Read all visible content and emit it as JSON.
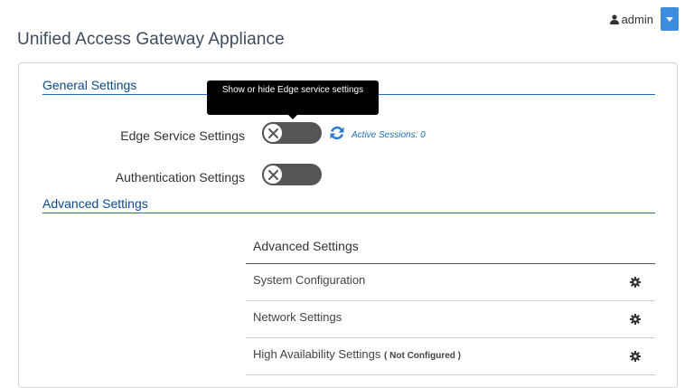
{
  "header": {
    "title": "Unified Access Gateway Appliance",
    "user": {
      "name": "admin",
      "icon": "user-icon",
      "dropdown_icon": "caret-down-icon"
    }
  },
  "general": {
    "heading": "General Settings",
    "tooltip": "Show or hide Edge service settings",
    "edge": {
      "label": "Edge Service Settings",
      "toggle_on": false,
      "refresh_icon": "refresh-icon",
      "sessions": "Active Sessions: 0"
    },
    "auth": {
      "label": "Authentication Settings",
      "toggle_on": false
    }
  },
  "advanced": {
    "heading": "Advanced Settings",
    "table_header": "Advanced Settings",
    "rows": [
      {
        "label": "System Configuration",
        "note": "",
        "icon": "gear-icon"
      },
      {
        "label": "Network Settings",
        "note": "",
        "icon": "gear-icon"
      },
      {
        "label": "High Availability Settings",
        "note": "( Not Configured )",
        "icon": "gear-icon"
      }
    ]
  },
  "colors": {
    "accent": "#3c8dde",
    "heading": "#0a4a8c",
    "link": "#1d70b7",
    "toggle_off": "#555555"
  }
}
